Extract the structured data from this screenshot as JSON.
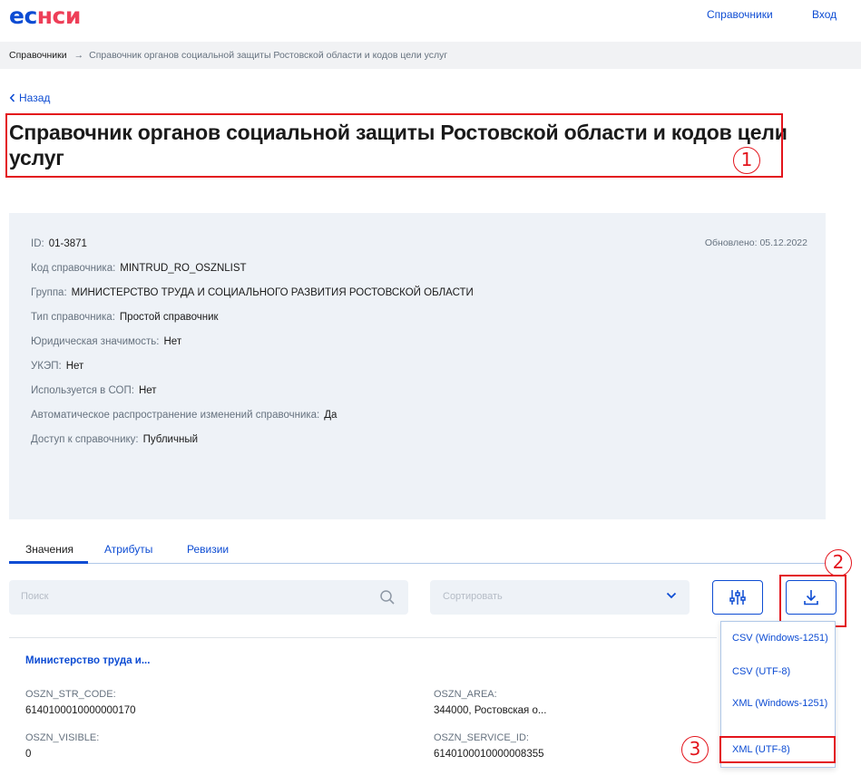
{
  "header": {
    "logo_part1": "ес",
    "logo_part2": "нси",
    "nav_directories": "Справочники",
    "nav_login": "Вход"
  },
  "breadcrumbs": {
    "root": "Справочники",
    "separator": "→",
    "current": "Справочник органов социальной защиты Ростовской области и кодов цели услуг"
  },
  "back_label": "Назад",
  "page_title": "Справочник органов социальной защиты Ростовской области и кодов цели услуг",
  "info": {
    "updated": "Обновлено: 05.12.2022",
    "rows": [
      {
        "label": "ID:",
        "value": "01-3871"
      },
      {
        "label": "Код справочника:",
        "value": "MINTRUD_RO_OSZNLIST"
      },
      {
        "label": "Группа:",
        "value": "МИНИСТЕРСТВО ТРУДА И СОЦИАЛЬНОГО РАЗВИТИЯ РОСТОВСКОЙ ОБЛАСТИ"
      },
      {
        "label": "Тип справочника:",
        "value": "Простой справочник"
      },
      {
        "label": "Юридическая значимость:",
        "value": "Нет"
      },
      {
        "label": "УКЭП:",
        "value": "Нет"
      },
      {
        "label": "Используется в СОП:",
        "value": "Нет"
      },
      {
        "label": "Автоматическое распространение изменений справочника:",
        "value": "Да"
      },
      {
        "label": "Доступ к справочнику:",
        "value": "Публичный"
      }
    ]
  },
  "tabs": [
    {
      "label": "Значения",
      "active": true
    },
    {
      "label": "Атрибуты",
      "active": false
    },
    {
      "label": "Ревизии",
      "active": false
    }
  ],
  "toolbar": {
    "search_placeholder": "Поиск",
    "sort_placeholder": "Сортировать",
    "filter_icon": "sliders-icon",
    "download_icon": "download-icon"
  },
  "card": {
    "title": "Министерство труда и...",
    "fields": [
      {
        "label": "OSZN_STR_CODE:",
        "value": "6140100010000000170"
      },
      {
        "label": "OSZN_AREA:",
        "value": "344000, Ростовская о..."
      },
      {
        "label": "OSZN_VISIBLE:",
        "value": "0"
      },
      {
        "label": "OSZN_SERVICE_ID:",
        "value": "6140100010000008355"
      }
    ]
  },
  "download_menu": [
    "CSV (Windows-1251)",
    "CSV (UTF-8)",
    "XML (Windows-1251)",
    "XML (UTF-8)"
  ],
  "annotations": [
    "1",
    "2",
    "3"
  ],
  "colors": {
    "accent": "#0d4cd3",
    "logo_red": "#ee3f58",
    "annotation_red": "#e3141c",
    "panel_bg": "#eef2f7"
  }
}
